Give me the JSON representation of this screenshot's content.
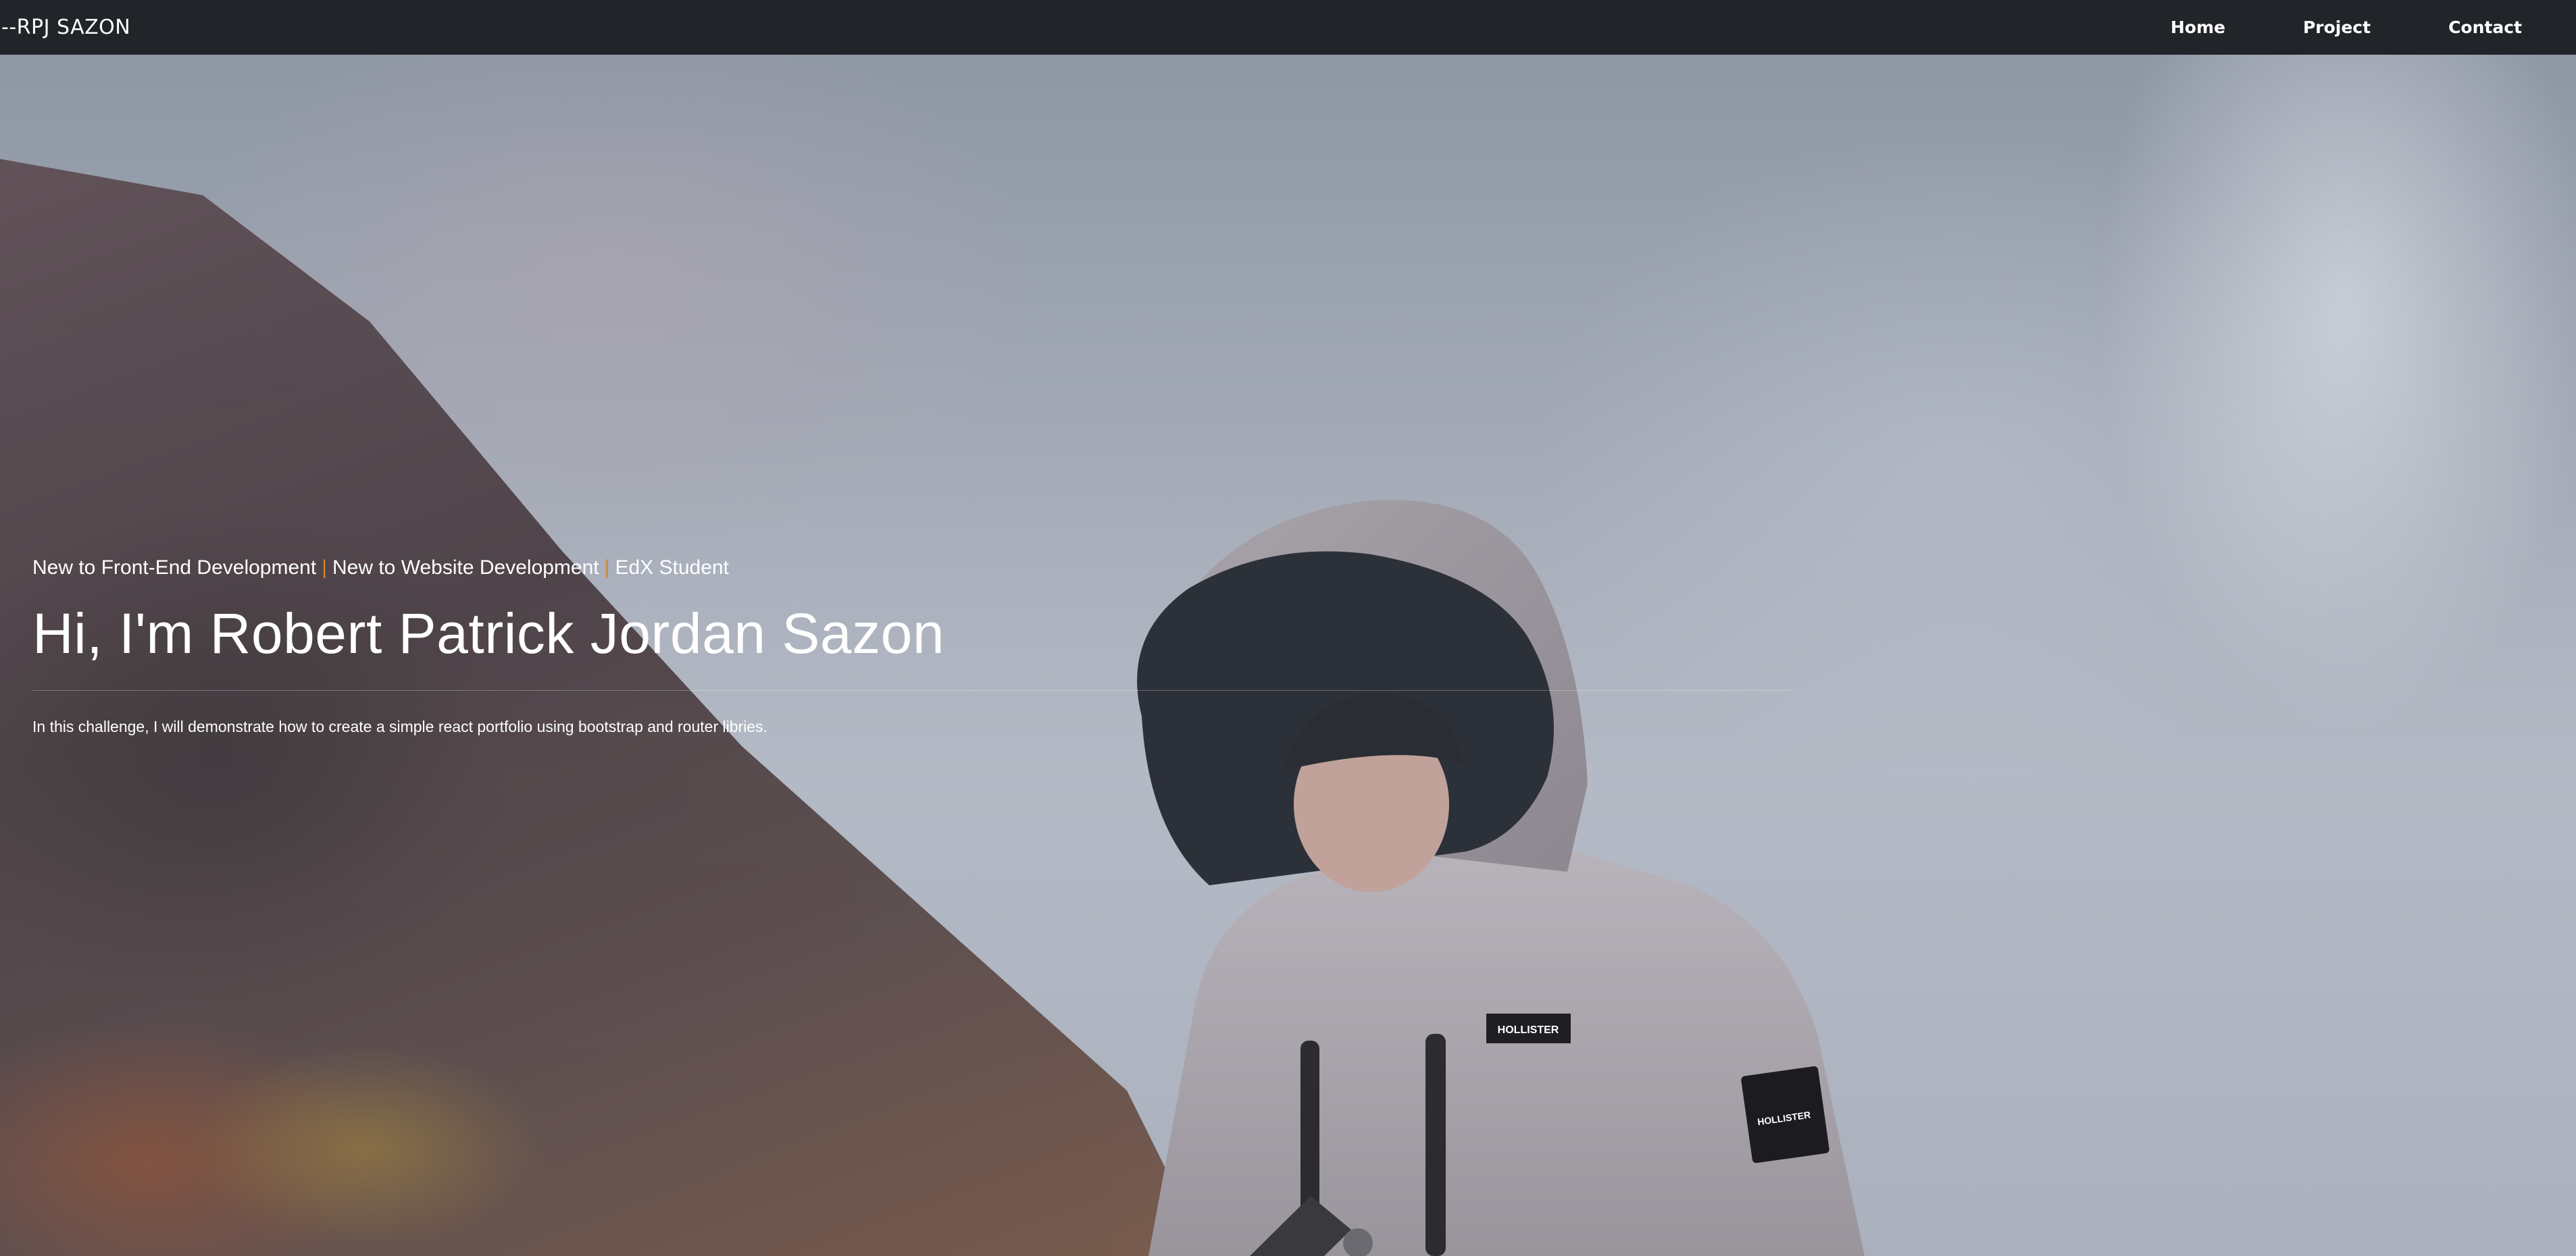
{
  "navbar": {
    "brand": "--RPJ SAZON",
    "links": [
      {
        "label": "Home"
      },
      {
        "label": "Project"
      },
      {
        "label": "Contact"
      }
    ]
  },
  "hero": {
    "tagline_items": [
      "New to Front-End Development",
      "New to Website Development",
      "EdX Student"
    ],
    "separator": "|",
    "headline": "Hi, I'm Robert Patrick Jordan Sazon",
    "description": "In this challenge, I will demonstrate how to create a simple react portfolio using bootstrap and router libries.",
    "jacket_brand": "HOLLISTER"
  },
  "colors": {
    "navbar_bg": "#212529",
    "nav_text": "#ffffff",
    "separator": "#d9822b"
  }
}
